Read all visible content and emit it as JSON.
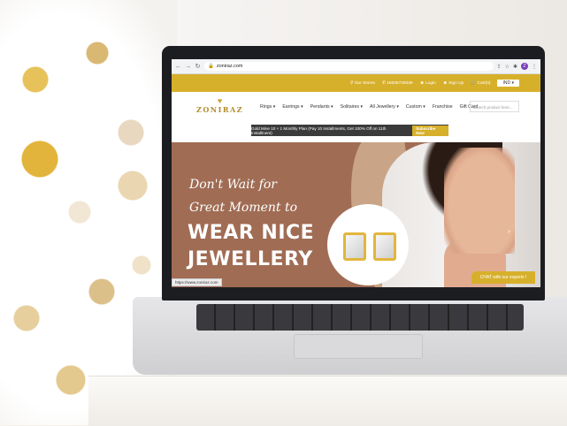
{
  "browser": {
    "url": "zoniraz.com",
    "profile_initial": "Z"
  },
  "topbar": {
    "our_stores": "Our Stores",
    "phone": "18005726039",
    "login": "Login",
    "signup": "Sign Up",
    "cart": "Cart(0)",
    "currency": "IND"
  },
  "brand": {
    "name": "ZONIRAZ"
  },
  "menu": {
    "items": [
      "Rings",
      "Earrings",
      "Pendants",
      "Solitaires",
      "All Jewellery",
      "Custom",
      "Franchise",
      "Gift Card"
    ]
  },
  "search": {
    "placeholder": "Search product here..."
  },
  "promo": {
    "text": "Gold Mine 10 + 1 Monthly Plan (Pay 10 Installments, Get 100% Off on 11th Installment)",
    "button": "Subscribe Now"
  },
  "hero": {
    "line1": "Don't Wait for",
    "line2": "Great Moment to",
    "line3": "WEAR NICE",
    "line4": "JEWELLERY"
  },
  "chat": {
    "label": "CHAT with our experts !"
  },
  "status_bar": {
    "url": "https://www.zoniraz.com"
  },
  "colors": {
    "accent": "#d7b02b",
    "hero_bg": "#a06c54",
    "promo_bg": "#3b3b3b"
  }
}
